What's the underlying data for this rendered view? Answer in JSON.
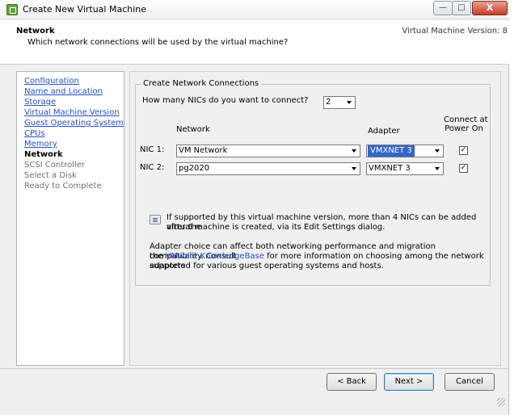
{
  "window": {
    "title": "Create New Virtual Machine",
    "controls": {
      "minimize": "—",
      "maximize": "□",
      "close": "X"
    }
  },
  "header": {
    "title": "Network",
    "subtitle": "Which network connections will be used by the virtual machine?",
    "vm_version": "Virtual Machine Version: 8"
  },
  "nav": {
    "items": [
      {
        "label": "Configuration",
        "state": "link"
      },
      {
        "label": "Name and Location",
        "state": "link"
      },
      {
        "label": "Storage",
        "state": "link"
      },
      {
        "label": "Virtual Machine Version",
        "state": "link"
      },
      {
        "label": "Guest Operating System",
        "state": "link"
      },
      {
        "label": "CPUs",
        "state": "link"
      },
      {
        "label": "Memory",
        "state": "link"
      },
      {
        "label": "Network",
        "state": "current"
      },
      {
        "label": "SCSI Controller",
        "state": "disabled"
      },
      {
        "label": "Select a Disk",
        "state": "disabled"
      },
      {
        "label": "Ready to Complete",
        "state": "disabled"
      }
    ]
  },
  "network": {
    "group_label": "Create Network Connections",
    "nic_count_question": "How many NICs do you want to connect?",
    "nic_count_value": "2",
    "col_network": "Network",
    "col_adapter": "Adapter",
    "col_connect_line1": "Connect at",
    "col_connect_line2": "Power On",
    "nics": [
      {
        "label": "NIC 1:",
        "network": "VM Network",
        "adapter": "VMXNET 3",
        "connect": true,
        "adapter_selected": true
      },
      {
        "label": "NIC 2:",
        "network": "pg2020",
        "adapter": "VMXNET 3",
        "connect": true,
        "adapter_selected": false
      }
    ],
    "info_line1": "If supported by this virtual machine version, more than 4 NICs can be added after the",
    "info_line2": "virtual machine is created, via its Edit Settings dialog.",
    "adapter_note_line1": "Adapter choice can affect both networking performance and migration compatibility. Consult",
    "adapter_note_pre": "the ",
    "adapter_note_link": "VMware KnowledgeBase",
    "adapter_note_post": " for more information on choosing among the network adapters",
    "adapter_note_line3": "supported for various guest operating systems and hosts.",
    "check_mark": "✓"
  },
  "footer": {
    "back_label": "< Back",
    "next_label": "Next >",
    "cancel_label": "Cancel"
  }
}
